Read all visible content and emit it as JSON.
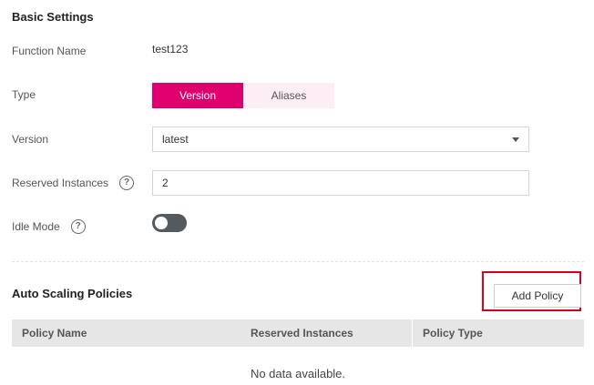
{
  "basic_settings": {
    "title": "Basic Settings",
    "function_name": {
      "label": "Function Name",
      "value": "test123"
    },
    "type": {
      "label": "Type",
      "options": [
        "Version",
        "Aliases"
      ],
      "selected": "Version"
    },
    "version": {
      "label": "Version",
      "value": "latest"
    },
    "reserved_instances": {
      "label": "Reserved Instances",
      "value": "2"
    },
    "idle_mode": {
      "label": "Idle Mode",
      "enabled": false
    }
  },
  "auto_scaling": {
    "title": "Auto Scaling Policies",
    "add_button": "Add Policy",
    "columns": [
      "Policy Name",
      "Reserved Instances",
      "Policy Type"
    ],
    "empty_message": "No data available."
  },
  "colors": {
    "accent": "#e0006d",
    "accent_light": "#fdeef5",
    "highlight": "#d9001b",
    "table_header": "#e6e6e6"
  },
  "icons": {
    "help": "question-circle-icon",
    "dropdown": "caret-down-icon"
  }
}
